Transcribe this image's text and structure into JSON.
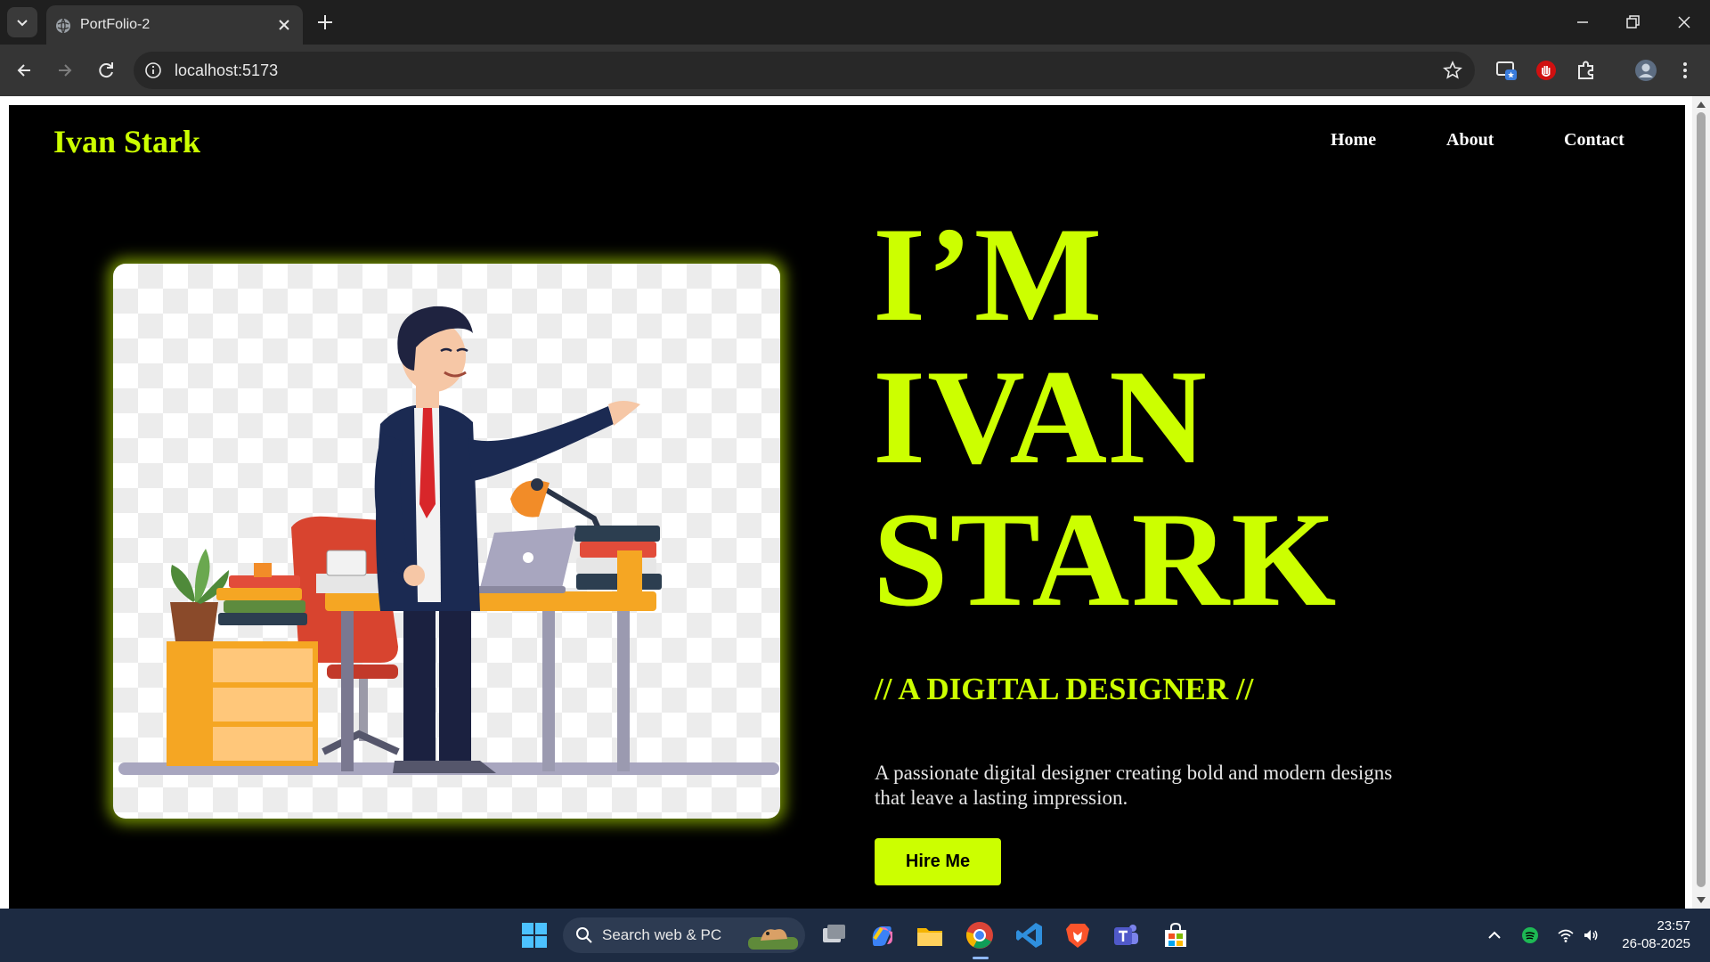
{
  "browser": {
    "tab_title": "PortFolio-2",
    "url": "localhost:5173"
  },
  "site": {
    "logo": "Ivan Stark",
    "nav": [
      "Home",
      "About",
      "Contact"
    ],
    "headline_lines": [
      "I’M",
      "IVAN",
      "STARK"
    ],
    "subheadline": "// A DIGITAL DESIGNER //",
    "description": "A passionate digital designer creating bold and modern designs that leave a lasting impression.",
    "cta_label": "Hire Me",
    "accent_color": "#ccff00",
    "background_color": "#000000"
  },
  "taskbar": {
    "search_placeholder": "Search web & PC",
    "time": "23:57",
    "date": "26-08-2025"
  }
}
